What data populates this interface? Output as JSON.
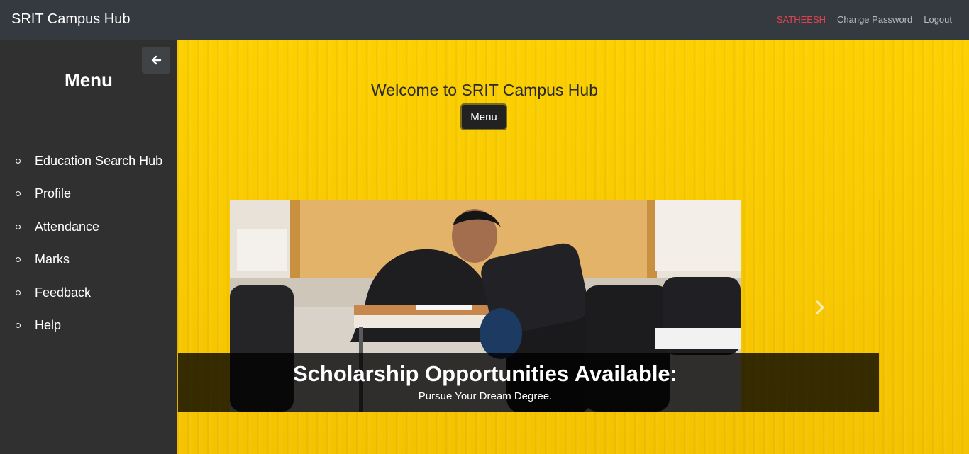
{
  "navbar": {
    "brand": "SRIT Campus Hub",
    "user": "SATHEESH",
    "change_password": "Change Password",
    "logout": "Logout"
  },
  "sidebar": {
    "title": "Menu",
    "collapse_icon": "arrow-left-icon",
    "items": [
      {
        "label": "Education Search Hub"
      },
      {
        "label": "Profile"
      },
      {
        "label": "Attendance"
      },
      {
        "label": "Marks"
      },
      {
        "label": "Feedback"
      },
      {
        "label": "Help"
      }
    ]
  },
  "main": {
    "welcome": "Welcome to SRIT Campus Hub",
    "menu_button": "Menu",
    "carousel": {
      "caption_title": "Scholarship Opportunities Available:",
      "caption_subtitle": "Pursue Your Dream Degree.",
      "next_icon": "chevron-right-icon"
    }
  },
  "colors": {
    "navbar": "#343a40",
    "sidebar": "#303030",
    "main_bg": "#f7c600",
    "user_name": "#e0434f"
  }
}
